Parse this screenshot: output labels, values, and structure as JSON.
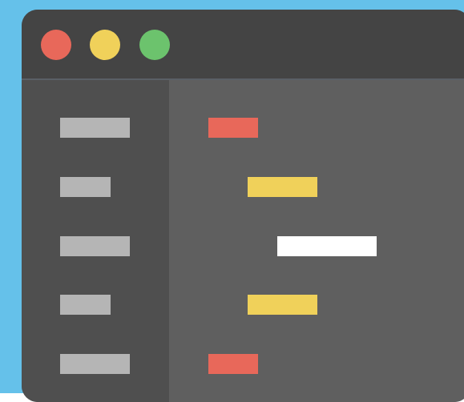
{
  "colors": {
    "background": "#65c1ea",
    "window_body": "#4a4a4a",
    "titlebar": "#444444",
    "titlebar_divider": "#5a5f66",
    "sidebar": "#4f4f4f",
    "editor": "#5f5f5f",
    "sidebar_item": "#b5b5b5",
    "light_red": "#e8685a",
    "light_yellow": "#f0d15a",
    "light_green": "#6cc36d",
    "code_red": "#e8685a",
    "code_yellow": "#f0d15a",
    "code_white": "#ffffff"
  },
  "window_controls": [
    {
      "name": "close-button",
      "icon": "circle",
      "color_key": "light_red"
    },
    {
      "name": "minimize-button",
      "icon": "circle",
      "color_key": "light_yellow"
    },
    {
      "name": "maximize-button",
      "icon": "circle",
      "color_key": "light_green"
    }
  ],
  "sidebar_items": [
    {
      "name": "sidebar-item-1",
      "color_key": "sidebar_item"
    },
    {
      "name": "sidebar-item-2",
      "color_key": "sidebar_item"
    },
    {
      "name": "sidebar-item-3",
      "color_key": "sidebar_item"
    },
    {
      "name": "sidebar-item-4",
      "color_key": "sidebar_item"
    },
    {
      "name": "sidebar-item-5",
      "color_key": "sidebar_item"
    }
  ],
  "code_lines": [
    {
      "name": "code-line-1",
      "color_key": "code_red"
    },
    {
      "name": "code-line-2",
      "color_key": "code_yellow"
    },
    {
      "name": "code-line-3",
      "color_key": "code_white"
    },
    {
      "name": "code-line-4",
      "color_key": "code_yellow"
    },
    {
      "name": "code-line-5",
      "color_key": "code_red"
    }
  ]
}
